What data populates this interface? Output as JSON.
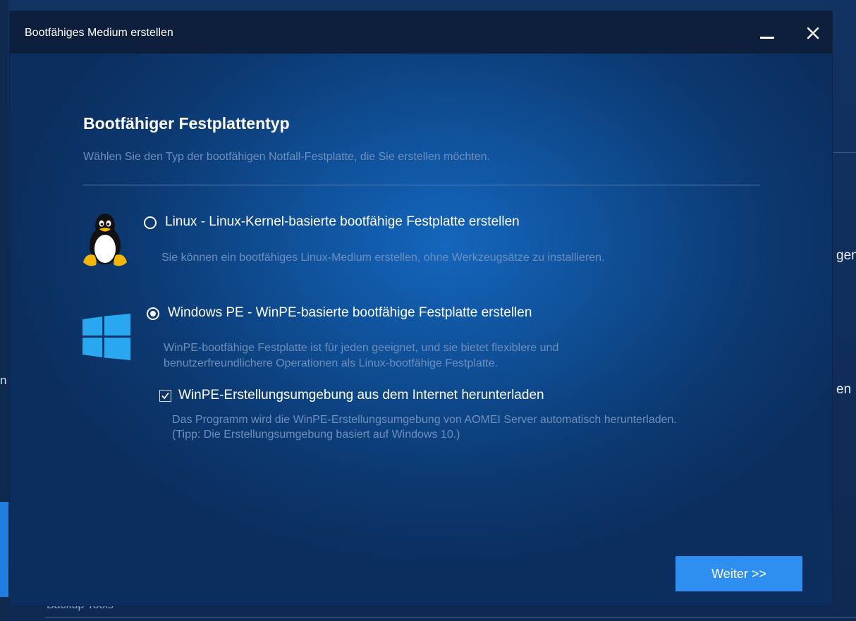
{
  "background": {
    "right_text_1": "gen",
    "right_text_2": "en",
    "left_char": "n",
    "bottom_text": "Backup Tools"
  },
  "dialog": {
    "title": "Bootfähiges Medium erstellen",
    "heading": "Bootfähiger Festplattentyp",
    "subheading": "Wählen Sie den Typ der bootfähigen Notfall-Festplatte, die Sie erstellen möchten.",
    "options": [
      {
        "label": "Linux - Linux-Kernel-basierte bootfähige Festplatte erstellen",
        "description": "Sie können ein bootfähiges Linux-Medium erstellen, ohne Werkzeugsätze zu installieren.",
        "selected": false,
        "icon": "linux-penguin-icon"
      },
      {
        "label": "Windows PE - WinPE-basierte bootfähige Festplatte erstellen",
        "description_line1": "WinPE-bootfähige Festplatte ist für jeden geeignet, und sie bietet flexiblere und",
        "description_line2": "benutzerfreundlichere Operationen als Linux-bootfähige Festplatte.",
        "selected": true,
        "icon": "windows-logo-icon"
      }
    ],
    "download_option": {
      "label": "WinPE-Erstellungsumgebung aus dem Internet herunterladen",
      "checked": true,
      "note_line1": "Das Programm wird die WinPE-Erstellungsumgebung von AOMEI Server automatisch herunterladen.",
      "note_line2": "(Tipp: Die Erstellungsumgebung basiert auf Windows 10.)"
    },
    "next_button": "Weiter >>"
  },
  "colors": {
    "accent": "#2f8ff0",
    "titlebar": "#0d1f3a",
    "description_text": "#6e8fbc"
  }
}
